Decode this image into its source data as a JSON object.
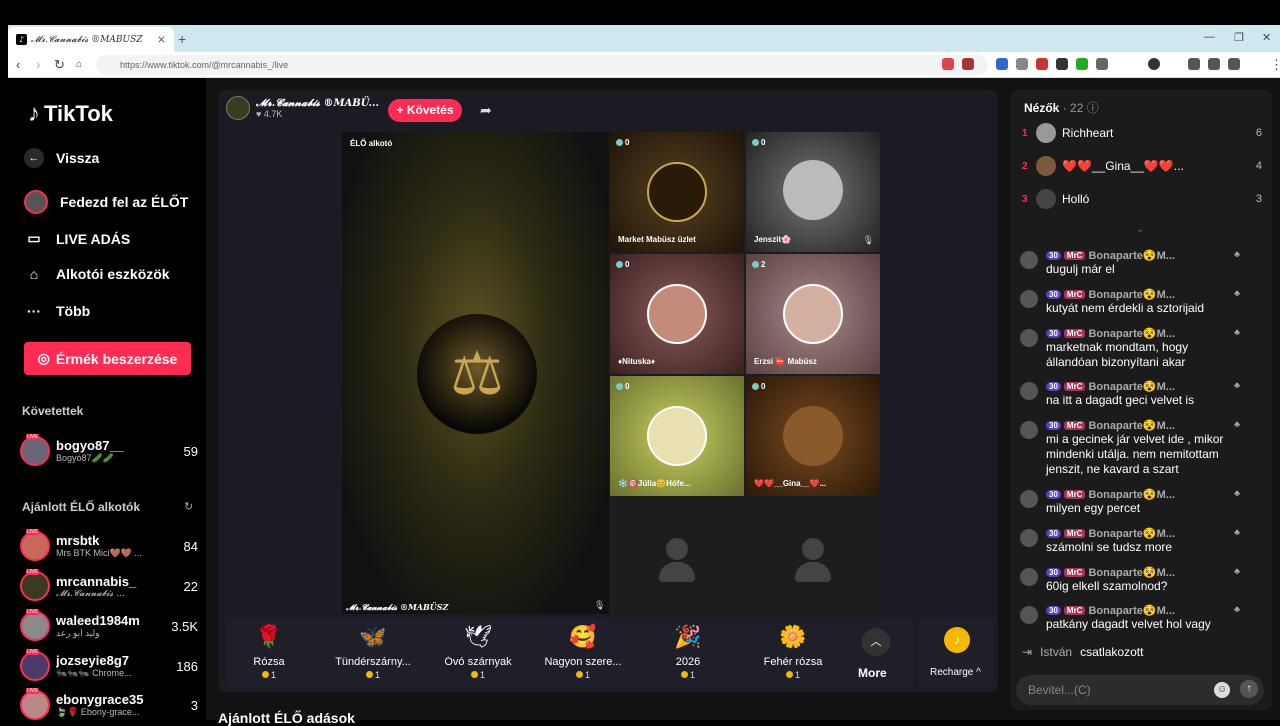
{
  "browser": {
    "tab_title": "𝓜𝓻.𝓒𝓪𝓷𝓷𝓪𝓫𝓲𝓼 ®MABÜSZ",
    "url": "https://www.tiktok.com/@mrcannabis_/live"
  },
  "sidebar": {
    "logo": "TikTok",
    "back": "Vissza",
    "nav": [
      {
        "label": "Fedezd fel az ÉLŐT",
        "icon": "avatar-icon"
      },
      {
        "label": "LIVE ADÁS",
        "icon": "camera-icon"
      },
      {
        "label": "Alkotói eszközök",
        "icon": "creator-tools-icon"
      },
      {
        "label": "Több",
        "icon": "more-icon"
      }
    ],
    "coins_button": "Érmék beszerzése",
    "following_title": "Követettek",
    "following": [
      {
        "name": "bogyo87__",
        "sub": "Bogyó87🥒🥒",
        "count": "59"
      }
    ],
    "recommended_title": "Ajánlott ÉLŐ alkotók",
    "recommended": [
      {
        "name": "mrsbtk",
        "sub": "Mrs BTK Mici🤎🤎 ...",
        "count": "84"
      },
      {
        "name": "mrcannabis_",
        "sub": "𝓜𝓻.𝓒𝓪𝓷𝓷𝓪𝓫𝓲𝓼 ...",
        "count": "22"
      },
      {
        "name": "waleed1984m",
        "sub": "وليد ابو رعد",
        "count": "3.5K"
      },
      {
        "name": "jozseyie8g7",
        "sub": "🐜🐜🐜 Chrome...",
        "count": "186"
      },
      {
        "name": "ebonygrace35",
        "sub": "🍃🌹 Ebony-grace...",
        "count": "3"
      }
    ]
  },
  "stream": {
    "host_name": "𝓜𝓻.𝓒𝓪𝓷𝓷𝓪𝓫𝓲𝓼 ®MABÜ...",
    "host_likes": "♥ 4.7K",
    "follow_label": "+ Követés",
    "creator_tag": "ÉLŐ alkotó",
    "host_footer": "𝓜𝓻.𝓒𝓪𝓷𝓷𝓪𝓫𝓲𝓼 ®MABÜSZ",
    "guests": [
      {
        "label": "Market Mabüsz üzlet",
        "badge": "0"
      },
      {
        "label": "Jenszit🌸",
        "badge": "0"
      },
      {
        "label": "♦Nituska♦",
        "badge": "0"
      },
      {
        "label": "Erzsi ⛔ Mabüsz",
        "badge": "2"
      },
      {
        "label": "❄️🎯Júlia😊Hófe...",
        "badge": "0"
      },
      {
        "label": "❤️❤️__Gina__❤️...",
        "badge": "0"
      }
    ],
    "gifts": [
      {
        "name": "Rózsa",
        "price": "1",
        "icon": "🌹"
      },
      {
        "name": "Tündérszárny...",
        "price": "1",
        "icon": "🦋"
      },
      {
        "name": "Óvó szárnyak",
        "price": "1",
        "icon": "🕊"
      },
      {
        "name": "Nagyon szere...",
        "price": "1",
        "icon": "🥰"
      },
      {
        "name": "2026",
        "price": "1",
        "icon": "🎉"
      },
      {
        "name": "Fehér rózsa",
        "price": "1",
        "icon": "🌼"
      }
    ],
    "more_label": "More",
    "recharge_label": "Recharge ^",
    "recommended_section": "Ajánlott ÉLŐ adások"
  },
  "chat": {
    "viewers_title": "Nézők",
    "viewers_count": "· 22",
    "viewers": [
      {
        "rank": "1",
        "name": "Richheart",
        "count": "6"
      },
      {
        "rank": "2",
        "name": "❤️❤️__Gina__❤️❤️...",
        "count": "4"
      },
      {
        "rank": "3",
        "name": "Holló",
        "count": "3"
      }
    ],
    "messages": [
      {
        "level": "30",
        "tag": "MrC",
        "user": "Bonaparte😵M...",
        "text": "dugulj már el"
      },
      {
        "level": "30",
        "tag": "MrC",
        "user": "Bonaparte😵M...",
        "text": "kutyát nem érdekli a sztorijaid"
      },
      {
        "level": "30",
        "tag": "MrC",
        "user": "Bonaparte😵M...",
        "text": "marketnak mondtam, hogy állandóan bizonyítani akar"
      },
      {
        "level": "30",
        "tag": "MrC",
        "user": "Bonaparte😵M...",
        "text": "na itt a dagadt geci velvet is"
      },
      {
        "level": "30",
        "tag": "MrC",
        "user": "Bonaparte😵M...",
        "text": "mi a gecinek jár velvet ide , mikor mindenki utálja. nem nemitottam jenszit, ne kavard a szart"
      },
      {
        "level": "30",
        "tag": "MrC",
        "user": "Bonaparte😵M...",
        "text": "milyen egy percet"
      },
      {
        "level": "30",
        "tag": "MrC",
        "user": "Bonaparte😵M...",
        "text": "számolni se tudsz more"
      },
      {
        "level": "30",
        "tag": "MrC",
        "user": "Bonaparte😵M...",
        "text": "60ig elkell szamolnod?"
      },
      {
        "level": "30",
        "tag": "MrC",
        "user": "Bonaparte😵M...",
        "text": "patkány dagadt velvet hol vagy"
      }
    ],
    "joined_user": "István",
    "joined_text": "csatlakozott",
    "input_placeholder": "Bevitel...(C)"
  }
}
